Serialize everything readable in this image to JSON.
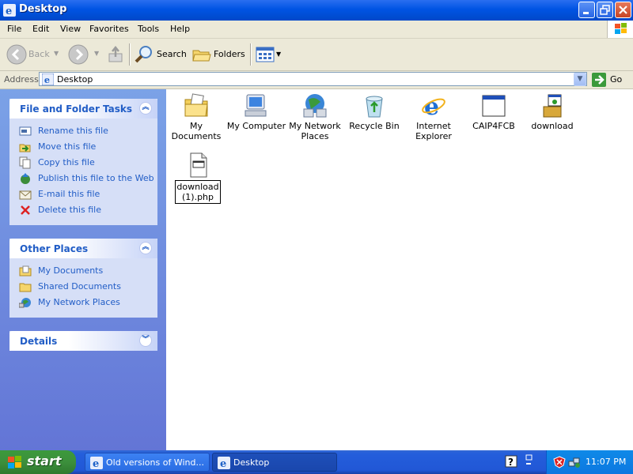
{
  "window": {
    "title": "Desktop"
  },
  "menu": [
    "File",
    "Edit",
    "View",
    "Favorites",
    "Tools",
    "Help"
  ],
  "toolbar": {
    "back": "Back",
    "search": "Search",
    "folders": "Folders"
  },
  "address": {
    "label": "Address",
    "value": "Desktop",
    "go": "Go"
  },
  "sidebar": {
    "file_tasks": {
      "title": "File and Folder Tasks",
      "items": [
        "Rename this file",
        "Move this file",
        "Copy this file",
        "Publish this file to the Web",
        "E-mail this file",
        "Delete this file"
      ]
    },
    "other_places": {
      "title": "Other Places",
      "items": [
        "My Documents",
        "Shared Documents",
        "My Network Places"
      ]
    },
    "details": {
      "title": "Details"
    }
  },
  "desktop": {
    "icons": [
      {
        "label": "My Documents",
        "icon": "my-documents-icon"
      },
      {
        "label": "My Computer",
        "icon": "my-computer-icon"
      },
      {
        "label": "My Network Places",
        "icon": "network-places-icon"
      },
      {
        "label": "Recycle Bin",
        "icon": "recycle-bin-icon"
      },
      {
        "label": "Internet Explorer",
        "icon": "internet-explorer-icon"
      },
      {
        "label": "CAIP4FCB",
        "icon": "window-file-icon"
      },
      {
        "label": "download",
        "icon": "installer-icon"
      }
    ],
    "selected_file": {
      "label": "download (1).php",
      "icon": "php-file-icon"
    }
  },
  "taskbar": {
    "start": "start",
    "tasks": [
      "Old versions of Wind...",
      "Desktop"
    ],
    "clock": "11:07 PM"
  }
}
